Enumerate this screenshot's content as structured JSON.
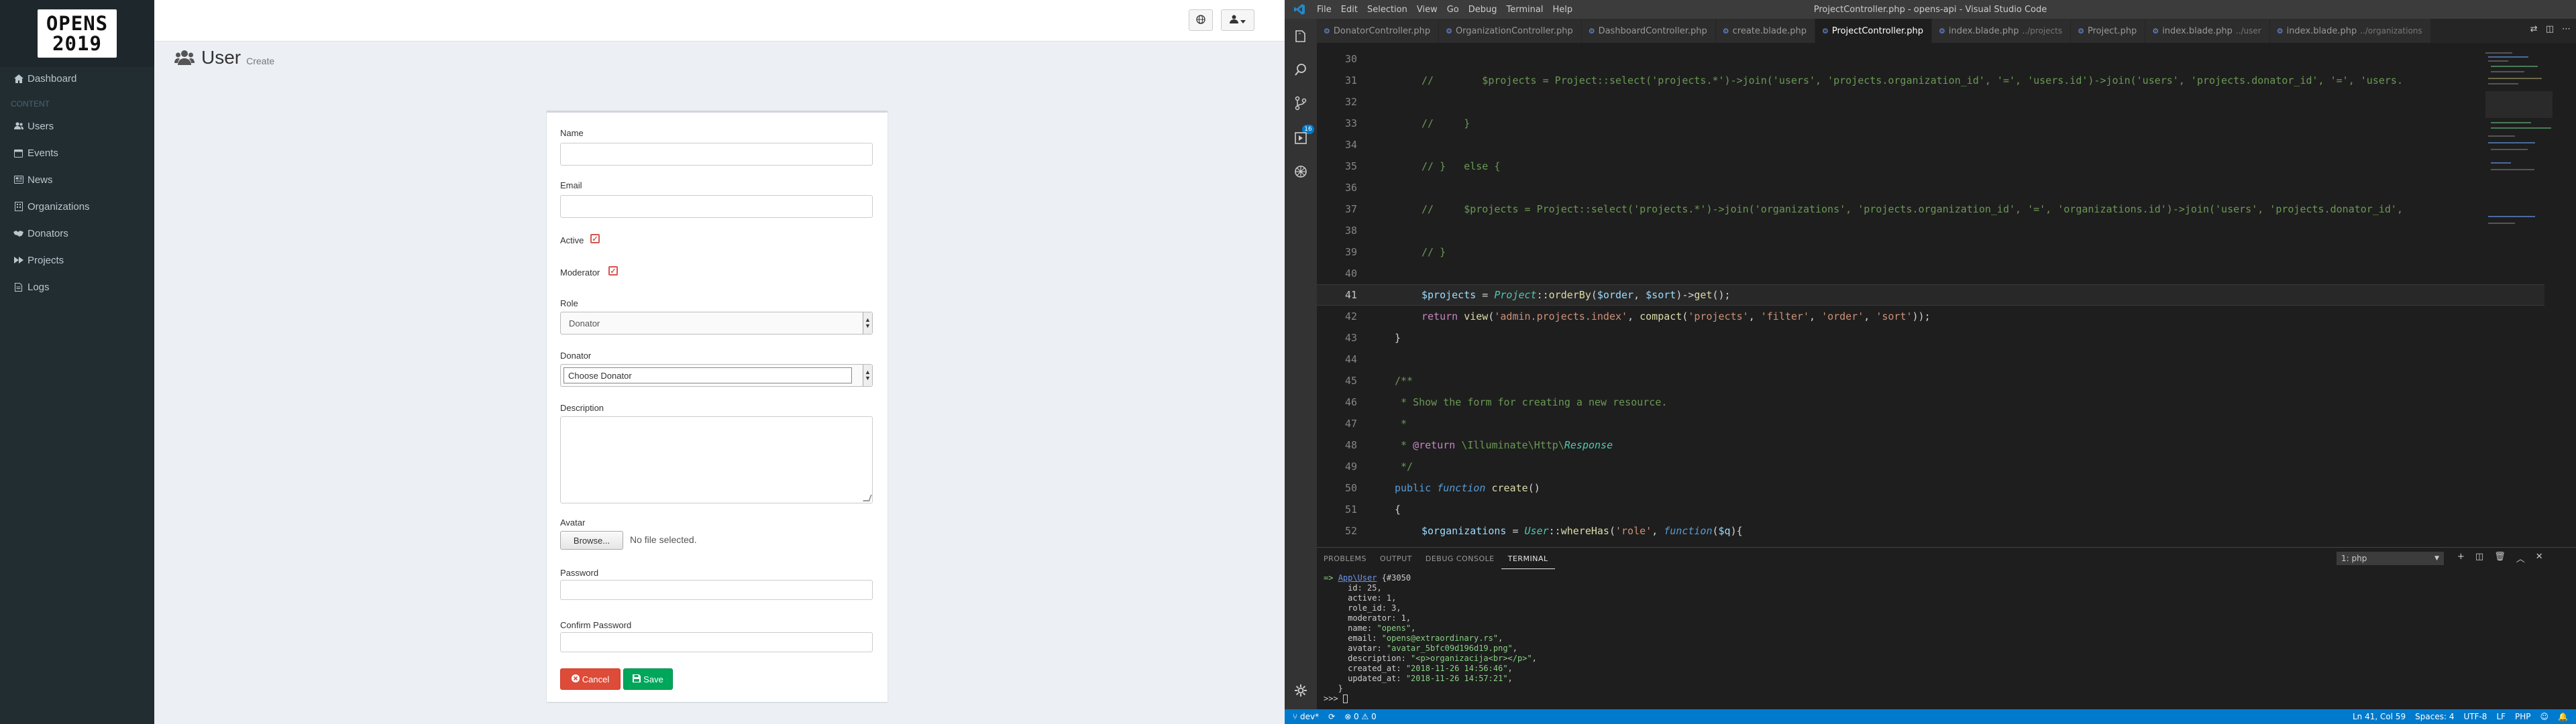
{
  "browser": {
    "logo": {
      "line1": "OPENS",
      "line2": "2019"
    },
    "nav": {
      "dashboard": "Dashboard",
      "section": "CONTENT",
      "items": [
        "Users",
        "Events",
        "News",
        "Organizations",
        "Donators",
        "Projects",
        "Logs"
      ]
    },
    "page": {
      "title": "User",
      "subtitle": "Create"
    },
    "form": {
      "name_label": "Name",
      "email_label": "Email",
      "active_label": "Active",
      "moderator_label": "Moderator",
      "role_label": "Role",
      "role_value": "Donator",
      "donator_label": "Donator",
      "donator_value": "Choose Donator",
      "description_label": "Description",
      "avatar_label": "Avatar",
      "browse_label": "Browse...",
      "file_status": "No file selected.",
      "password_label": "Password",
      "confirm_label": "Confirm Password",
      "cancel_label": "Cancel",
      "save_label": "Save"
    }
  },
  "vscode": {
    "title": "ProjectController.php - opens-api - Visual Studio Code",
    "menu": [
      "File",
      "Edit",
      "Selection",
      "View",
      "Go",
      "Debug",
      "Terminal",
      "Help"
    ],
    "scm_badge": "16",
    "tabs": [
      {
        "label": "DonatorController.php",
        "dim": ""
      },
      {
        "label": "OrganizationController.php",
        "dim": ""
      },
      {
        "label": "DashboardController.php",
        "dim": ""
      },
      {
        "label": "create.blade.php",
        "dim": ""
      },
      {
        "label": "ProjectController.php",
        "dim": ""
      },
      {
        "label": "index.blade.php",
        "dim": "../projects"
      },
      {
        "label": "Project.php",
        "dim": ""
      },
      {
        "label": "index.blade.php",
        "dim": "../user"
      },
      {
        "label": "index.blade.php",
        "dim": "../organizations"
      }
    ],
    "lines": [
      "30",
      "31",
      "32",
      "33",
      "34",
      "35",
      "36",
      "37",
      "38",
      "39",
      "40",
      "41",
      "42",
      "43",
      "44",
      "45",
      "46",
      "47",
      "48",
      "49",
      "50",
      "51",
      "52"
    ],
    "code": {
      "l31": "//        $projects = Project::select('projects.*')->join('users', 'projects.organization_id', '=', 'users.id')->join('users', 'projects.donator_id', '=', 'users.",
      "l33": "//     }",
      "l35a": "// }   ",
      "l35b": "else {",
      "l37": "//     $projects = Project::select('projects.*')->join('organizations', 'projects.organization_id', '=', 'organizations.id')->join('users', 'projects.donator_id',",
      "l39": "// }",
      "l41a": "$projects",
      "l41b": " = ",
      "l41c": "Project",
      "l41d": "::",
      "l41e": "orderBy",
      "l41f": "(",
      "l41g": "$order",
      "l41h": ", ",
      "l41i": "$sort",
      "l41j": ")->",
      "l41k": "get",
      "l41l": "();",
      "l42a": "return ",
      "l42b": "view",
      "l42c": "(",
      "l42d": "'admin.projects.index'",
      "l42e": ", ",
      "l42f": "compact",
      "l42g": "(",
      "l42h": "'projects'",
      "l42i": ", ",
      "l42j": "'filter'",
      "l42k": ", ",
      "l42l": "'order'",
      "l42m": ", ",
      "l42n": "'sort'",
      "l42o": "));",
      "l43": "}",
      "l45": "/**",
      "l46": " * Show the form for creating a new resource.",
      "l47": " *",
      "l48a": " * ",
      "l48b": "@return",
      "l48c": " \\Illuminate\\Http\\",
      "l48d": "Response",
      "l49": " */",
      "l50a": "public ",
      "l50b": "function ",
      "l50c": "create",
      "l50d": "()",
      "l51": "{",
      "l52a": "$organizations",
      "l52b": " = ",
      "l52c": "User",
      "l52d": "::",
      "l52e": "whereHas",
      "l52f": "(",
      "l52g": "'role'",
      "l52h": ", ",
      "l52i": "function",
      "l52j": "(",
      "l52k": "$q",
      "l52l": "){"
    },
    "panel_tabs": [
      "PROBLEMS",
      "OUTPUT",
      "DEBUG CONSOLE",
      "TERMINAL"
    ],
    "terminal_select": "1: php",
    "terminal": {
      "t1a": "=> ",
      "t1b": "App\\User",
      "t1c": " {#3050",
      "t2": "     id: 25,",
      "t3": "     active: 1,",
      "t4": "     role_id: 3,",
      "t5": "     moderator: 1,",
      "t6a": "     name: ",
      "t6b": "\"opens\"",
      "t6c": ",",
      "t7a": "     email: ",
      "t7b": "\"opens@extraordinary.rs\"",
      "t7c": ",",
      "t8a": "     avatar: ",
      "t8b": "\"avatar_5bfc09d196d19.png\"",
      "t8c": ",",
      "t9a": "     description: ",
      "t9b": "\"<p>organizacija<br></p>\"",
      "t9c": ",",
      "t10a": "     created_at: ",
      "t10b": "\"2018-11-26 14:56:46\"",
      "t10c": ",",
      "t11a": "     updated_at: ",
      "t11b": "\"2018-11-26 14:57:21\"",
      "t11c": ",",
      "t12": "   }",
      "t13": ">>> "
    },
    "status": {
      "branch": "dev*",
      "sync": "⟳",
      "problems": "⊗ 0 ⚠ 0",
      "position": "Ln 41, Col 59",
      "spaces": "Spaces: 4",
      "encoding": "UTF-8",
      "eol": "LF",
      "language": "PHP"
    }
  }
}
